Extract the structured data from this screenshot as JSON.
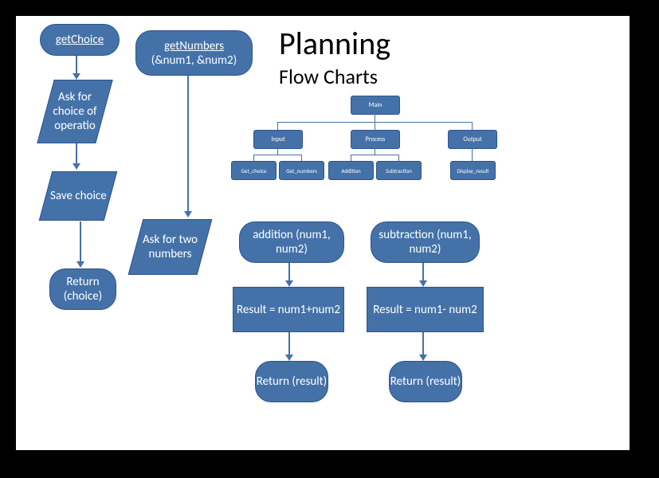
{
  "title": "Planning",
  "subtitle": "Flow Charts",
  "flowchart": {
    "getChoice": {
      "start": "getChoice",
      "step1": "Ask for choice of operatio",
      "step2": "Save choice",
      "end": "Return (choice)"
    },
    "getNumbers": {
      "start_line1": "getNumbers",
      "start_line2": "(&num1, &num2)",
      "step1": "Ask for two numbers"
    },
    "addition": {
      "start": "addition (num1, num2)",
      "step1": "Result = num1+num2",
      "end": "Return (result)"
    },
    "subtraction": {
      "start": "subtraction (num1, num2)",
      "step1": "Result = num1- num2",
      "end": "Return (result)"
    }
  },
  "orgchart": {
    "root": "Main",
    "level1": [
      "Input",
      "Process",
      "Output"
    ],
    "level2": [
      "Get_choice",
      "Get_numbers",
      "Addition",
      "Subtraction",
      "Display_result"
    ]
  },
  "chart_data": {
    "type": "flowchart",
    "flows": [
      {
        "name": "getChoice",
        "nodes": [
          {
            "type": "terminator",
            "label": "getChoice"
          },
          {
            "type": "io",
            "label": "Ask for choice of operation"
          },
          {
            "type": "io",
            "label": "Save choice"
          },
          {
            "type": "terminator",
            "label": "Return (choice)"
          }
        ]
      },
      {
        "name": "getNumbers",
        "nodes": [
          {
            "type": "terminator",
            "label": "getNumbers (&num1, &num2)"
          },
          {
            "type": "io",
            "label": "Ask for two numbers"
          }
        ]
      },
      {
        "name": "addition",
        "nodes": [
          {
            "type": "terminator",
            "label": "addition (num1, num2)"
          },
          {
            "type": "process",
            "label": "Result = num1+num2"
          },
          {
            "type": "terminator",
            "label": "Return (result)"
          }
        ]
      },
      {
        "name": "subtraction",
        "nodes": [
          {
            "type": "terminator",
            "label": "subtraction (num1, num2)"
          },
          {
            "type": "process",
            "label": "Result = num1-num2"
          },
          {
            "type": "terminator",
            "label": "Return (result)"
          }
        ]
      }
    ],
    "hierarchy": {
      "Main": {
        "Input": [
          "Get_choice",
          "Get_numbers"
        ],
        "Process": [
          "Addition",
          "Subtraction"
        ],
        "Output": [
          "Display_result"
        ]
      }
    }
  }
}
